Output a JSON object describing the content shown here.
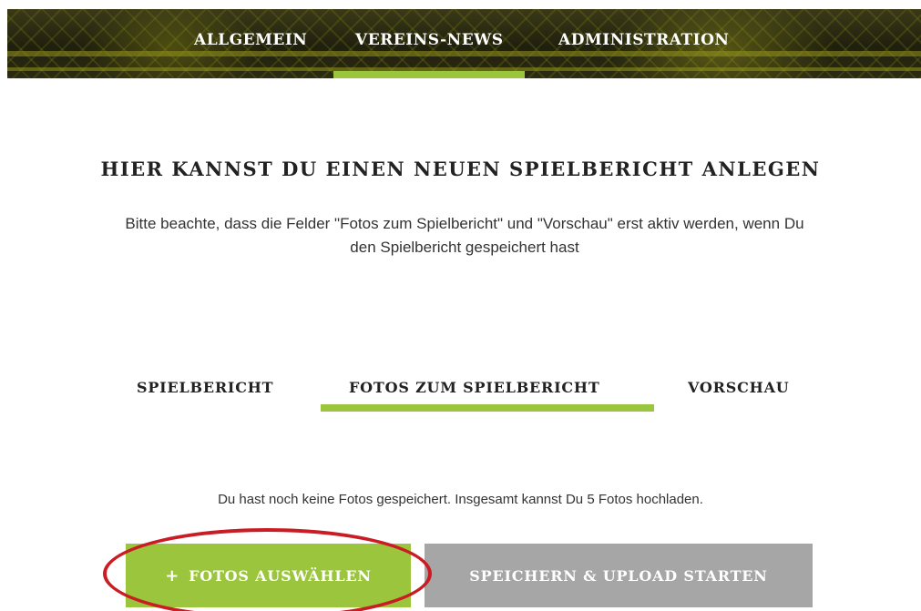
{
  "nav": {
    "items": [
      {
        "label": "ALLGEMEIN",
        "active": false
      },
      {
        "label": "VEREINS-NEWS",
        "active": true
      },
      {
        "label": "ADMINISTRATION",
        "active": false
      }
    ]
  },
  "page": {
    "title": "HIER KANNST DU EINEN NEUEN SPIELBERICHT ANLEGEN",
    "intro_line1": "Bitte beachte, dass die Felder \"Fotos zum Spielbericht\" und \"Vorschau\" erst aktiv werden, wenn Du",
    "intro_line2": "den Spielbericht gespeichert hast"
  },
  "tabs": [
    {
      "label": "SPIELBERICHT",
      "active": false
    },
    {
      "label": "FOTOS ZUM SPIELBERICHT",
      "active": true
    },
    {
      "label": "VORSCHAU",
      "active": false
    }
  ],
  "photos": {
    "info": "Du hast noch keine Fotos gespeichert. Insgesamt kannst Du 5 Fotos hochladen.",
    "select_icon": "+",
    "select_label": "FOTOS AUSWÄHLEN",
    "upload_label": "SPEICHERN & UPLOAD STARTEN"
  },
  "colors": {
    "accent_green": "#9bc53d",
    "button_grey": "#a6a6a6",
    "highlight_red": "#c91c23",
    "banner_dark": "#2a2a12"
  }
}
